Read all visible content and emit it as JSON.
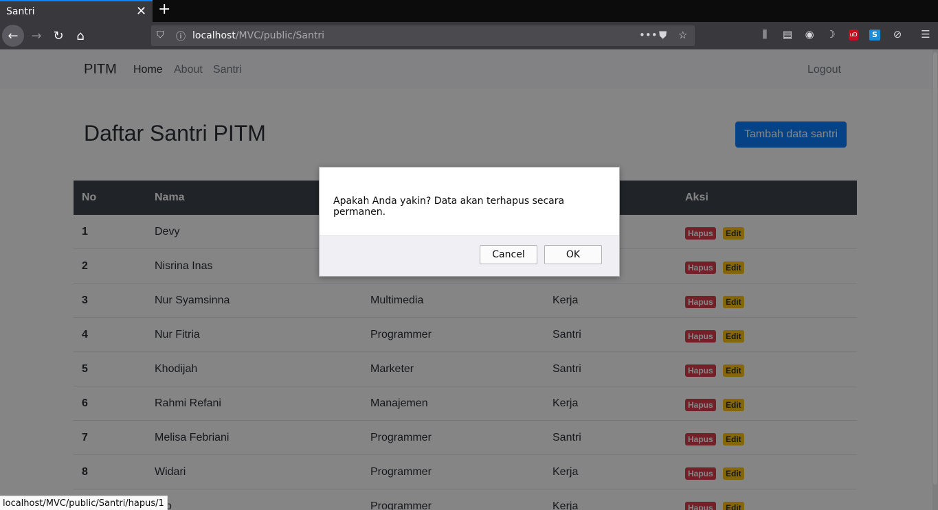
{
  "browser": {
    "tab_title": "Santri",
    "tab_close": "✕",
    "new_tab": "+",
    "url_host": "localhost",
    "url_path": "/MVC/public/Santri",
    "status_url": "localhost/MVC/public/Santri/hapus/1",
    "page_actions": "•••",
    "ublock_label": "uD",
    "ext_s_label": "S"
  },
  "site": {
    "brand": "PITM",
    "nav": {
      "home": "Home",
      "about": "About",
      "santri": "Santri",
      "logout": "Logout"
    },
    "title": "Daftar Santri PITM",
    "add_button": "Tambah data santri"
  },
  "table": {
    "headers": {
      "no": "No",
      "nama": "Nama",
      "aksi": "Aksi"
    },
    "rows": [
      {
        "no": "1",
        "nama": "Devy",
        "col3": "",
        "col4": ""
      },
      {
        "no": "2",
        "nama": "Nisrina Inas",
        "col3": "",
        "col4": ""
      },
      {
        "no": "3",
        "nama": "Nur Syamsinna",
        "col3": "Multimedia",
        "col4": "Kerja"
      },
      {
        "no": "4",
        "nama": "Nur Fitria",
        "col3": "Programmer",
        "col4": "Santri"
      },
      {
        "no": "5",
        "nama": "Khodijah",
        "col3": "Marketer",
        "col4": "Santri"
      },
      {
        "no": "6",
        "nama": "Rahmi Refani",
        "col3": "Manajemen",
        "col4": "Kerja"
      },
      {
        "no": "7",
        "nama": "Melisa Febriani",
        "col3": "Programmer",
        "col4": "Santri"
      },
      {
        "no": "8",
        "nama": "Widari",
        "col3": "Programmer",
        "col4": "Kerja"
      },
      {
        "no": "",
        "nama": "lalo",
        "col3": "Programmer",
        "col4": "Kerja"
      }
    ],
    "hapus_label": "Hapus",
    "edit_label": "Edit"
  },
  "dialog": {
    "message": "Apakah Anda yakin? Data akan terhapus secara permanen.",
    "cancel": "Cancel",
    "ok": "OK"
  }
}
